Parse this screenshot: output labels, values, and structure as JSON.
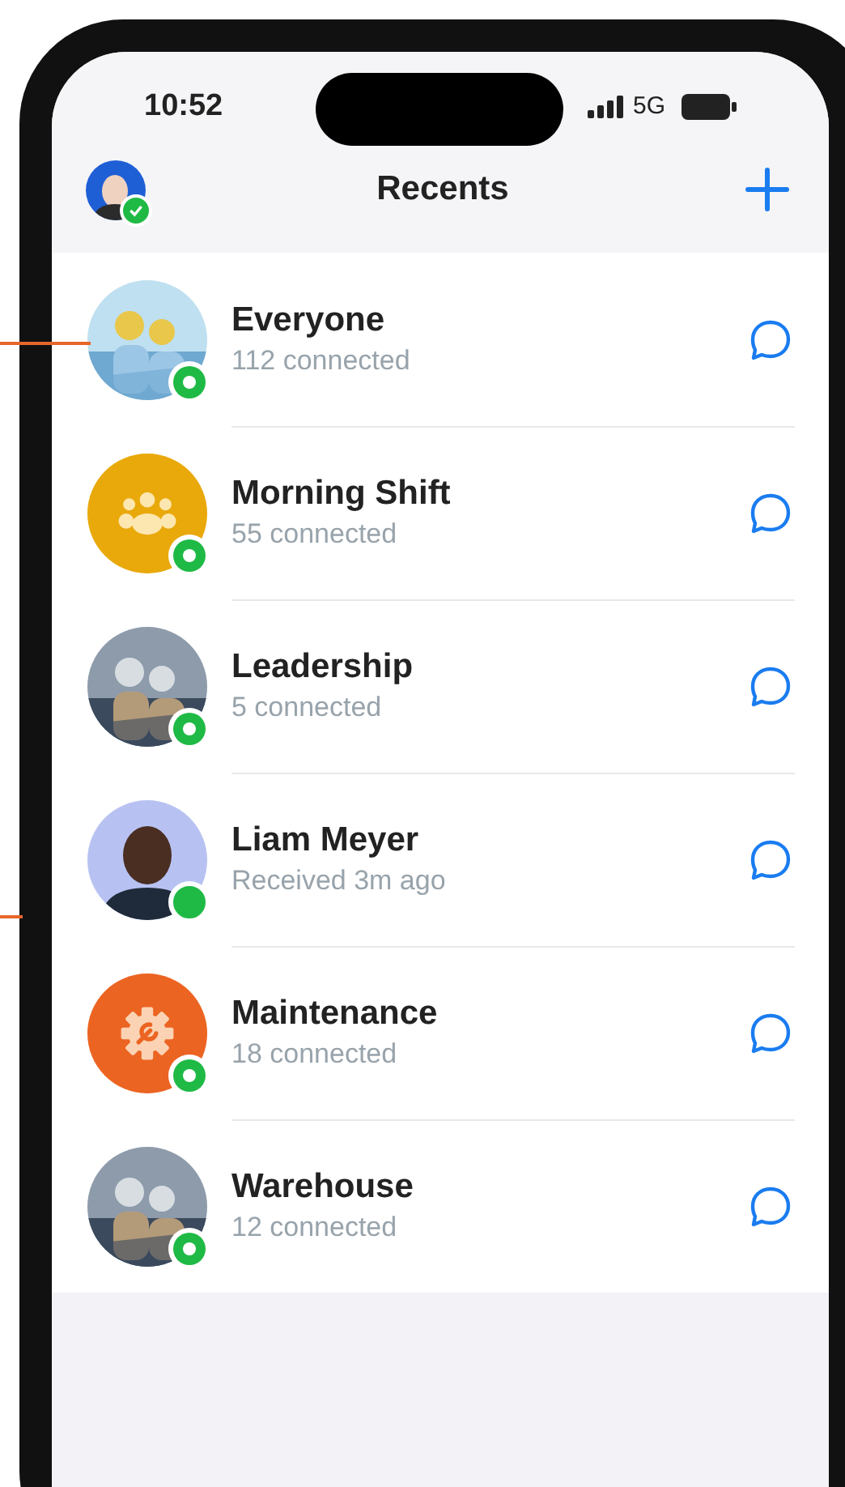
{
  "status_bar": {
    "time": "10:52",
    "network": "5G"
  },
  "nav": {
    "title": "Recents",
    "profile_online": true
  },
  "conversations": [
    {
      "name": "Everyone",
      "subtitle": "112 connected",
      "badge": {
        "kind": "ring"
      }
    },
    {
      "name": "Morning Shift",
      "subtitle": "55 connected",
      "avatar": {
        "kind": "group",
        "color": "#e9a90b"
      },
      "badge": {
        "kind": "ring"
      }
    },
    {
      "name": "Leadership",
      "subtitle": "5 connected",
      "badge": {
        "kind": "ring"
      }
    },
    {
      "name": "Liam Meyer",
      "subtitle": "Received 3m ago",
      "avatar": {
        "kind": "person",
        "color": "#b8c2f2"
      },
      "badge": {
        "kind": "dot"
      }
    },
    {
      "name": "Maintenance",
      "subtitle": "18 connected",
      "avatar": {
        "kind": "gear",
        "color": "#ec6421"
      },
      "badge": {
        "kind": "ring"
      }
    },
    {
      "name": "Warehouse",
      "subtitle": "12 connected",
      "badge": {
        "kind": "ring"
      }
    }
  ]
}
